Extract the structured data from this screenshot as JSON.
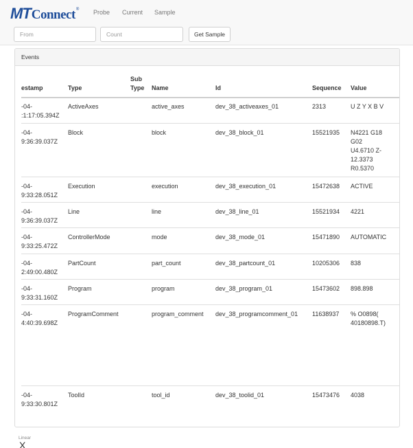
{
  "brand": {
    "mt": "MT",
    "connect": "Connect",
    "reg": "®"
  },
  "nav": [
    {
      "label": "Probe"
    },
    {
      "label": "Current"
    },
    {
      "label": "Sample"
    }
  ],
  "query": {
    "from_placeholder": "From",
    "count_placeholder": "Count",
    "from_value": "",
    "count_value": "",
    "button_label": "Get Sample"
  },
  "events_panel": {
    "title": "Events",
    "headers": {
      "timestamp": "estamp",
      "type": "Type",
      "subtype": "Sub\nType",
      "name": "Name",
      "id": "Id",
      "sequence": "Sequence",
      "value": "Value"
    },
    "rows": [
      {
        "timestamp": "-04-\n:1:17:05.394Z",
        "type": "ActiveAxes",
        "subtype": "",
        "name": "active_axes",
        "id": "dev_38_activeaxes_01",
        "sequence": "2313",
        "value": "U Z Y X B V"
      },
      {
        "timestamp": "-04-\n9:36:39.037Z",
        "type": "Block",
        "subtype": "",
        "name": "block",
        "id": "dev_38_block_01",
        "sequence": "15521935",
        "value": "N4221 G18\nG02\nU4.6710 Z-\n12.3373\nR0.5370"
      },
      {
        "timestamp": "-04-\n9:33:28.051Z",
        "type": "Execution",
        "subtype": "",
        "name": "execution",
        "id": "dev_38_execution_01",
        "sequence": "15472638",
        "value": "ACTIVE"
      },
      {
        "timestamp": "-04-\n9:36:39.037Z",
        "type": "Line",
        "subtype": "",
        "name": "line",
        "id": "dev_38_line_01",
        "sequence": "15521934",
        "value": "4221"
      },
      {
        "timestamp": "-04-\n9:33:25.472Z",
        "type": "ControllerMode",
        "subtype": "",
        "name": "mode",
        "id": "dev_38_mode_01",
        "sequence": "15471890",
        "value": "AUTOMATIC"
      },
      {
        "timestamp": "-04-\n2:49:00.480Z",
        "type": "PartCount",
        "subtype": "",
        "name": "part_count",
        "id": "dev_38_partcount_01",
        "sequence": "10205306",
        "value": "838"
      },
      {
        "timestamp": "-04-\n9:33:31.160Z",
        "type": "Program",
        "subtype": "",
        "name": "program",
        "id": "dev_38_program_01",
        "sequence": "15473602",
        "value": "898.898"
      },
      {
        "timestamp": "-04-\n4:40:39.698Z",
        "type": "ProgramComment",
        "subtype": "",
        "name": "program_comment",
        "id": "dev_38_programcomment_01",
        "sequence": "11638937",
        "value": "% O0898(\n40180898.T)"
      },
      {
        "timestamp": "-04-\n9:33:30.801Z",
        "type": "ToolId",
        "subtype": "",
        "name": "tool_id",
        "id": "dev_38_toolid_01",
        "sequence": "15473476",
        "value": "4038"
      }
    ]
  },
  "linear": {
    "label": "Linear",
    "axis": "X"
  }
}
